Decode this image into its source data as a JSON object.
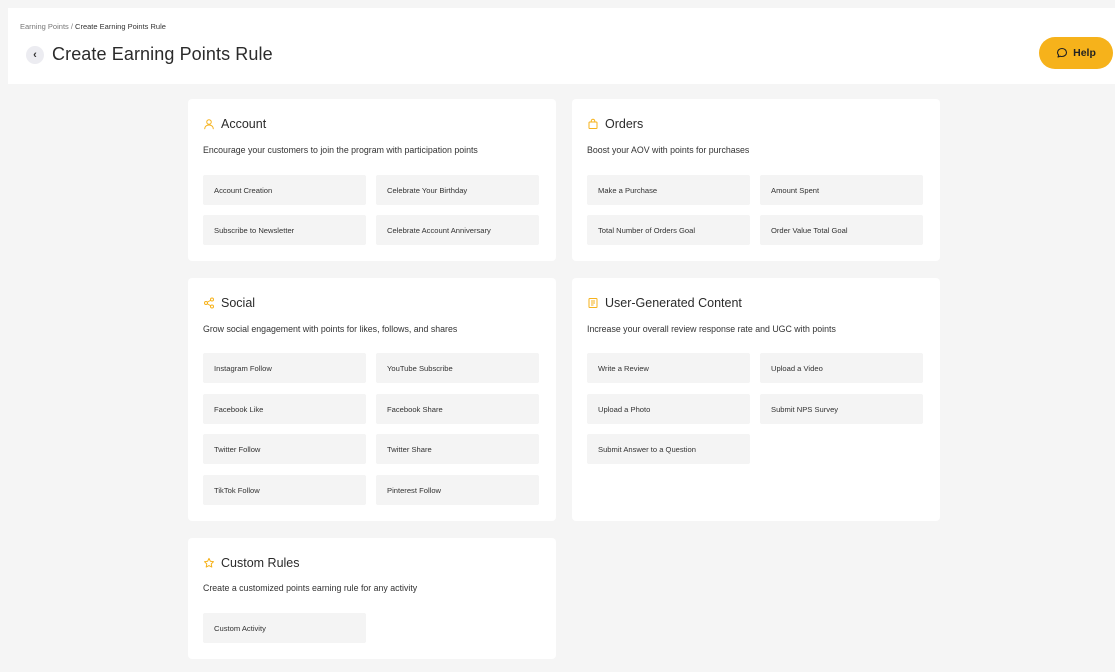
{
  "breadcrumb": {
    "parent": "Earning Points",
    "separator": " / ",
    "current": "Create Earning Points Rule"
  },
  "header": {
    "back_symbol": "‹",
    "title": "Create Earning Points Rule",
    "help_label": "Help"
  },
  "accent_color": "#f6b21b",
  "cards": {
    "account": {
      "icon": "user-icon",
      "title": "Account",
      "description": "Encourage your customers to join the program with participation points",
      "options": [
        "Account Creation",
        "Celebrate Your Birthday",
        "Subscribe to Newsletter",
        "Celebrate Account Anniversary"
      ]
    },
    "orders": {
      "icon": "shopping-bag-icon",
      "title": "Orders",
      "description": "Boost your AOV with points for purchases",
      "options": [
        "Make a Purchase",
        "Amount Spent",
        "Total Number of Orders Goal",
        "Order Value Total Goal"
      ]
    },
    "social": {
      "icon": "share-icon",
      "title": "Social",
      "description": "Grow social engagement with points for likes, follows, and shares",
      "options": [
        "Instagram Follow",
        "YouTube Subscribe",
        "Facebook Like",
        "Facebook Share",
        "Twitter Follow",
        "Twitter Share",
        "TikTok Follow",
        "Pinterest Follow"
      ]
    },
    "ugc": {
      "icon": "document-icon",
      "title": "User-Generated Content",
      "description": "Increase your overall review response rate and UGC with points",
      "options": [
        "Write a Review",
        "Upload a Video",
        "Upload a Photo",
        "Submit NPS Survey",
        "Submit Answer to a Question"
      ]
    },
    "custom": {
      "icon": "star-icon",
      "title": "Custom Rules",
      "description": "Create a customized points earning rule for any activity",
      "options": [
        "Custom Activity"
      ]
    }
  }
}
